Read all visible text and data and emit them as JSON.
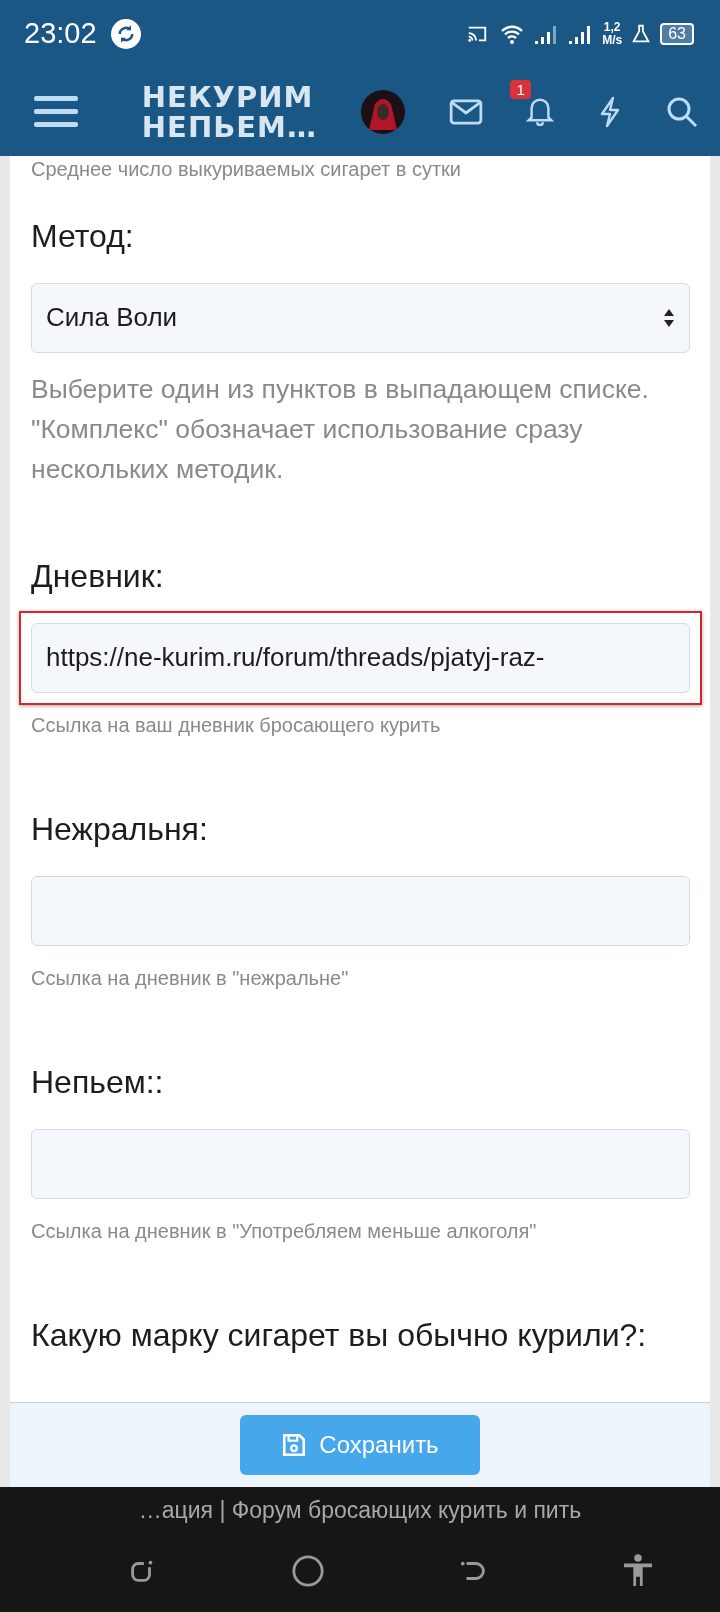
{
  "status_bar": {
    "time": "23:02",
    "speed_value": "1,2",
    "speed_unit": "M/s",
    "battery": "63"
  },
  "header": {
    "logo_lines": [
      "НЕКУРИМ",
      "НЕПЬЕМ…"
    ],
    "notification_count": "1"
  },
  "form": {
    "fields": [
      {
        "kind": "hint",
        "text": "Среднее число выкуриваемых сигарет в сутки"
      },
      {
        "kind": "select",
        "label": "Метод:",
        "value": "Сила Воли",
        "help": "Выберите один из пунктов в выпадающем списке. \"Комплекс\" обозначает использование сразу нескольких методик.",
        "highlighted": false
      },
      {
        "kind": "text",
        "label": "Дневник:",
        "value": "https://ne-kurim.ru/forum/threads/pjatyj-raz-",
        "help": "Ссылка на ваш дневник бросающего курить",
        "highlighted": true
      },
      {
        "kind": "text",
        "label": "Нежральня:",
        "help": "Ссылка на дневник в \"нежральне\"",
        "highlighted": false
      },
      {
        "kind": "text",
        "label": "Непьем::",
        "help": "Ссылка на дневник в \"Употребляем меньше алкоголя\"",
        "highlighted": false
      },
      {
        "kind": "heading",
        "label": "Какую марку сигарет вы обычно курили?:"
      }
    ]
  },
  "footer": {
    "save_button": "Сохранить"
  },
  "browser_bar": {
    "page_title": "…ация | Форум бросающих курить и пить"
  }
}
